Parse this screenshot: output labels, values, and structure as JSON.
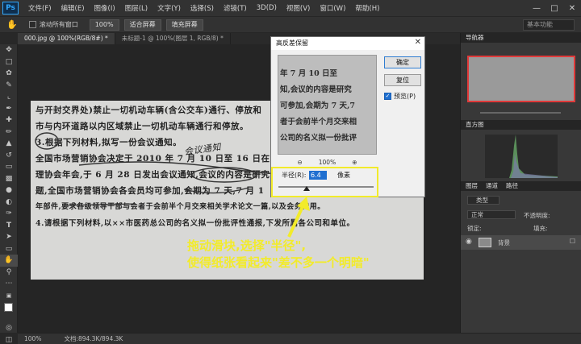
{
  "app": {
    "logo": "Ps",
    "menu": [
      "文件(F)",
      "编辑(E)",
      "图像(I)",
      "图层(L)",
      "文字(Y)",
      "选择(S)",
      "滤镜(T)",
      "3D(D)",
      "视图(V)",
      "窗口(W)",
      "帮助(H)"
    ]
  },
  "options": {
    "scroll_all": "滚动所有窗口",
    "zoom": "100%",
    "fit_screen": "适合屏幕",
    "fill_screen": "填充屏幕",
    "workspace": "基本功能"
  },
  "tabs": [
    "000.jpg @ 100%(RGB/8#) *",
    "未标题-1 @ 100%(图层 1, RGB/8) *"
  ],
  "document": {
    "lines": [
      "与开封交界处)禁止一切机动车辆(含公交车)通行、停放和",
      "市与内环道路以内区域禁止一切机动车辆通行和停放。",
      "3.根据下列材料,拟写一份会议通知。",
      "全国市场营销协会决定于 2010 年 7 月 10 日至 16 日在",
      "理协会年会,于 6 月 28 日发出会议通知,会议的内容是研究",
      "题,全国市场营销协会各会员均可参加,会期为 7 天,7 月 1",
      "年部件,要求各级领导干部与会者于会前半个月交来相关学术论文一篇,以及会务费用。",
      "4.请根据下列材料,以××市医药总公司的名义拟一份批评性通报,下发所属各公司和单位。"
    ],
    "handwriting": "会议通知"
  },
  "status": {
    "zoom": "100%",
    "doc_size": "文档:894.3K/894.3K"
  },
  "panels": {
    "navigator": "导航器",
    "histogram": "直方图",
    "layers_tabs": [
      "图层",
      "通道",
      "路径"
    ],
    "kind": "类型",
    "blend_mode": "正常",
    "opacity_label": "不透明度:",
    "lock_label": "锁定:",
    "fill_label": "填充:",
    "layer_name": "背景"
  },
  "dialog": {
    "title": "高反差保留",
    "ok": "确定",
    "reset": "复位",
    "preview": "预览(P)",
    "zoom": "100%",
    "radius_label": "半径(R):",
    "radius_value": "6.4",
    "radius_unit": "像素",
    "preview_lines": [
      "年 7 月 10 日至",
      "知,会议的内容是研究",
      "可参加,会期为 7 天,7",
      "者于会前半个月交来相",
      "公司的名义拟一份批评"
    ]
  },
  "annotation": {
    "line1": "拖动滑块,选择\"半径\",",
    "line2": "使得纸张看起来\"差不多一个明暗\""
  },
  "colors": {
    "accent_yellow": "#f2eb2b",
    "ps_blue": "#31a8ff"
  }
}
